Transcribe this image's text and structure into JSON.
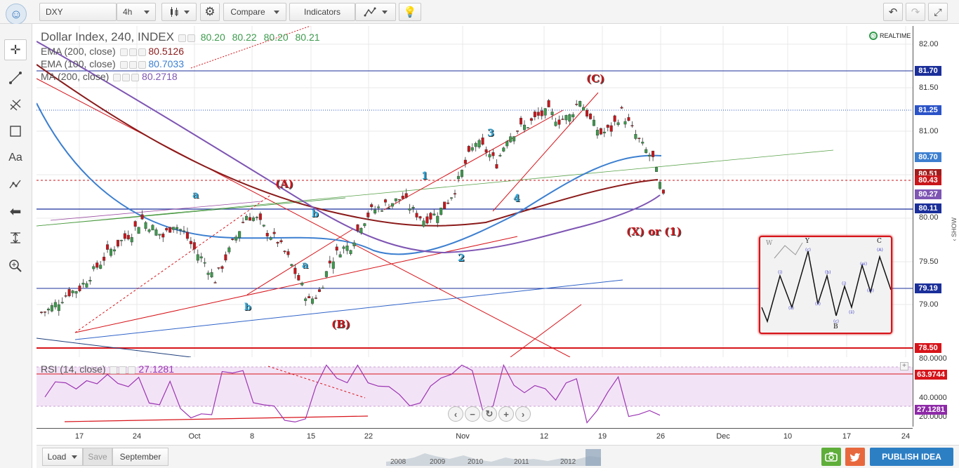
{
  "toolbar": {
    "symbol": "DXY",
    "interval": "4h",
    "compare_label": "Compare",
    "indicators_label": "Indicators"
  },
  "legend": {
    "title": "Dollar Index, 240, INDEX",
    "ohlc": [
      "80.20",
      "80.22",
      "80.20",
      "80.21"
    ],
    "ema200_label": "EMA (200, close)",
    "ema200_value": "80.5126",
    "ema100_label": "EMA (100, close)",
    "ema100_value": "80.7033",
    "ma200_label": "MA (200, close)",
    "ma200_value": "80.2718",
    "realtime": "REALTIME"
  },
  "rsi_legend": {
    "label": "RSI (14, close)",
    "value": "27.1281"
  },
  "price_axis": {
    "labels": [
      "82.00",
      "81.50",
      "81.00",
      "80.00",
      "79.50",
      "79.00"
    ],
    "tags": [
      {
        "value": "81.70",
        "color": "#1b2f9a"
      },
      {
        "value": "81.25",
        "color": "#2b53c8"
      },
      {
        "value": "80.70",
        "color": "#3c7fd0"
      },
      {
        "value": "80.51",
        "color": "#a11c1c"
      },
      {
        "value": "80.43",
        "color": "#c8161b"
      },
      {
        "value": "80.27",
        "color": "#7e55b3"
      },
      {
        "value": "80.11",
        "color": "#1b2f9a"
      },
      {
        "value": "79.19",
        "color": "#1b2f9a"
      },
      {
        "value": "78.50",
        "color": "#d7141a"
      }
    ]
  },
  "rsi_axis": {
    "labels": [
      "80.0000",
      "40.0000",
      "20.0000"
    ],
    "tags": [
      {
        "value": "63.9744",
        "color": "#d7141a"
      },
      {
        "value": "27.1281",
        "color": "#8e2aa8"
      }
    ]
  },
  "time_axis": {
    "labels": [
      "17",
      "24",
      "Oct",
      "8",
      "15",
      "22",
      "Nov",
      "12",
      "19",
      "26",
      "Dec",
      "10",
      "17",
      "24"
    ]
  },
  "annotations": {
    "wave_A": "(A)",
    "wave_B": "(B)",
    "wave_C": "(C)",
    "x_or_1": "(X) or (1)",
    "a_top": "a",
    "b_top": "b",
    "a_mid": "a",
    "b_bottom": "b",
    "n1": "1",
    "n2": "2",
    "n3": "3",
    "n4": "4"
  },
  "inset": {
    "labels": [
      "W",
      "Y",
      "B",
      "C"
    ]
  },
  "bottom_bar": {
    "load_label": "Load",
    "save_label": "Save",
    "layout_name": "September",
    "publish_label": "PUBLISH IDEA",
    "years": [
      "2008",
      "2009",
      "2010",
      "2011",
      "2012"
    ]
  },
  "side": {
    "show_label": "SHOW"
  },
  "chart_data": {
    "type": "candlestick",
    "title": "Dollar Index, 240, INDEX",
    "ylim": [
      78.35,
      82.2
    ],
    "x_labels": [
      "17",
      "24",
      "Oct",
      "8",
      "15",
      "22",
      "Nov",
      "12",
      "19",
      "26",
      "Dec",
      "10",
      "17",
      "24"
    ],
    "close_series": [
      78.9,
      79.0,
      79.1,
      79.15,
      79.3,
      79.45,
      79.6,
      79.7,
      79.8,
      79.95,
      79.85,
      79.75,
      79.9,
      79.8,
      79.6,
      79.45,
      79.25,
      79.5,
      79.75,
      80.0,
      79.95,
      79.8,
      79.7,
      79.5,
      79.25,
      79.0,
      79.1,
      79.45,
      79.6,
      79.65,
      79.9,
      80.05,
      80.1,
      80.15,
      80.2,
      80.05,
      79.95,
      80.0,
      80.1,
      80.3,
      80.6,
      80.85,
      80.75,
      80.6,
      80.9,
      81.0,
      81.05,
      81.15,
      81.2,
      81.1,
      81.15,
      81.35,
      81.1,
      80.95,
      81.0,
      81.2,
      81.0,
      80.8,
      80.65,
      80.2
    ]
  }
}
